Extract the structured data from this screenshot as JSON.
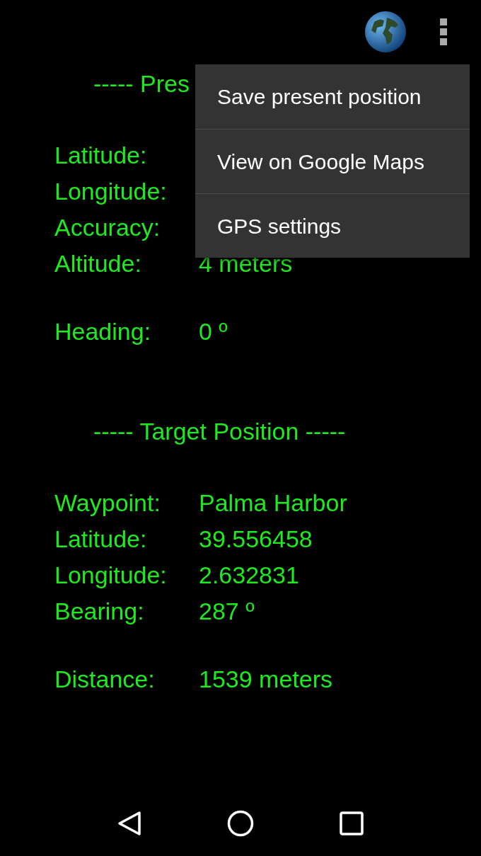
{
  "menu": {
    "items": [
      {
        "label": "Save present position"
      },
      {
        "label": "View on Google Maps"
      },
      {
        "label": "GPS settings"
      }
    ]
  },
  "sections": [
    {
      "header": "----- Pres",
      "groups": [
        [
          {
            "label": "Latitude:"
          },
          {
            "label": "Longitude:"
          },
          {
            "label": "Accuracy:"
          },
          {
            "label": "Altitude:",
            "value": "4 meters"
          }
        ],
        [
          {
            "label": "Heading:",
            "value": "0 º"
          }
        ]
      ]
    },
    {
      "header": "----- Target Position -----",
      "groups": [
        [
          {
            "label": "Waypoint:",
            "value": "Palma Harbor"
          },
          {
            "label": "Latitude:",
            "value": "39.556458"
          },
          {
            "label": "Longitude:",
            "value": "2.632831"
          },
          {
            "label": "Bearing:",
            "value": "287 º"
          }
        ],
        [
          {
            "label": "Distance:",
            "value": "1539 meters"
          }
        ]
      ]
    }
  ]
}
